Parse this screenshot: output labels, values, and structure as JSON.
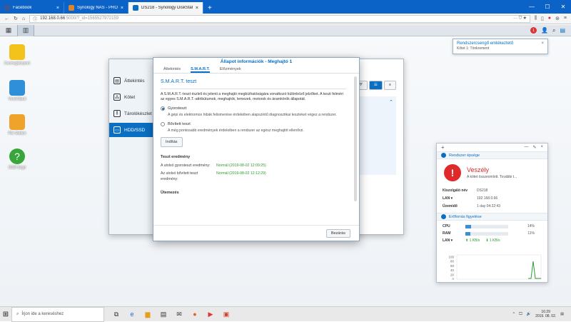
{
  "browser": {
    "tabs": [
      {
        "title": "Facebook",
        "color": "#3b5998"
      },
      {
        "title": "Synology NAS - PROHARDVER!",
        "color": "#e0862a"
      },
      {
        "title": "DS218 - Synology DiskStation",
        "color": "#0a6fc2",
        "active": true
      }
    ],
    "new_tab": "+",
    "url_host": "192.168.0.66",
    "url_rest": ":5000/?_id=1565527972159",
    "url_more": "··· ⛉ ★"
  },
  "dsm": {
    "notif_count": "1"
  },
  "desktop": {
    "icons": [
      {
        "label": "Csomagközpont",
        "color": "#f3c21b"
      },
      {
        "label": "Vezérlőpult",
        "color": "#2f8fd8"
      },
      {
        "label": "File Station",
        "color": "#f0a32a"
      },
      {
        "label": "DSM Súgó",
        "color": "#38a63a"
      }
    ]
  },
  "storage_manager": {
    "side": [
      "Áttekintés",
      "Kötet",
      "Tárolókészlet",
      "HDD/SSD"
    ]
  },
  "dialog": {
    "title": "Állapot információk - Meghajtó 1",
    "tabs": [
      "Áttekintés",
      "S.M.A.R.T.",
      "Előzmények"
    ],
    "section": "S.M.A.R.T. teszt",
    "intro": "A S.M.A.R.T.-teszt észleli és jelenti a meghajtó megbízhatóságára vonatkozó különböző jelzőket. A teszt felméri az egyes S.M.A.R.T.-attribútumok, meghajtók, lemezek, motorok és áramkörök állapotát.",
    "quick_label": "Gyorsteszt",
    "quick_desc": "A gépi és elektromos hibák felismerése érdekében alapszintű diagnosztikai teszteket végez a rendszer.",
    "ext_label": "Bővített teszt",
    "ext_desc": "A még pontosabb eredmények érdekében a rendszer az egész meghajtót ellenőrzi.",
    "start_btn": "Indítás",
    "results_title": "Teszt eredmény",
    "last_quick_key": "A utolsó gyorsteszt eredmény:",
    "last_quick_val": "Normál (2019-08-02 12:09:25)",
    "last_ext_key": "Az utolsó bővített teszt eredmény:",
    "last_ext_val": "Normál (2019-08-02 12:12:29)",
    "schedule_title": "Ütemezés",
    "close_btn": "Bezárás"
  },
  "notification": {
    "title": "Rendszercsengő emlékeztető",
    "sub": "Kötet 1: Tönkrement"
  },
  "widget": {
    "health_title": "Rendszer épsége",
    "status": "Veszély",
    "status_desc": "A kötet összeomlott. További t...",
    "server_name_k": "Kiszolgáló név",
    "server_name_v": "DS218",
    "lan_k": "LAN ▾",
    "lan_v": "192.168.0.66",
    "uptime_k": "Üzemidő",
    "uptime_v": "1 day 04:22:43",
    "res_title": "Erőforrás figyelése",
    "cpu_k": "CPU",
    "cpu_pct": 14,
    "cpu_label": "14%",
    "ram_k": "RAM",
    "ram_pct": 11,
    "ram_label": "11%",
    "net_k": "LAN ▾",
    "net_up": "⬆ 1 KB/s",
    "net_down": "⬇ 1 KB/s",
    "chart_ticks": [
      "100",
      "80",
      "60",
      "40",
      "20",
      "0"
    ]
  },
  "taskbar": {
    "search_placeholder": "Írjon ide a kereséshez",
    "time": "16:29",
    "date": "2019. 08. 02."
  }
}
